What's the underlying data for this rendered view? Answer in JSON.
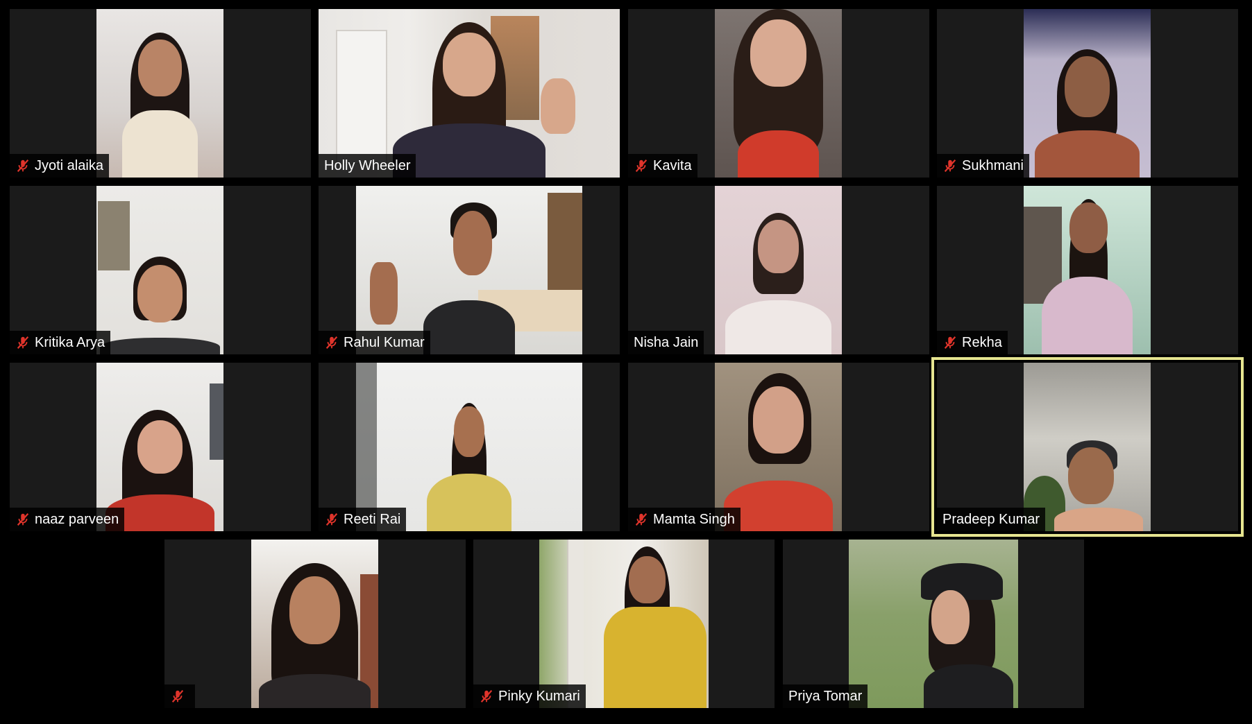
{
  "meeting": {
    "view": "gallery",
    "active_speaker": "Pradeep Kumar",
    "colors": {
      "background": "#000000",
      "tile": "#1b1b1b",
      "active_border": "#e6e590",
      "muted_icon": "#e0342b",
      "nameplate_text": "#ffffff"
    }
  },
  "participants": [
    {
      "name": "Jyoti alaika",
      "muted": true
    },
    {
      "name": "Holly Wheeler",
      "muted": false
    },
    {
      "name": "Kavita",
      "muted": true
    },
    {
      "name": "Sukhmani",
      "muted": true
    },
    {
      "name": "Kritika Arya",
      "muted": true
    },
    {
      "name": "Rahul Kumar",
      "muted": true
    },
    {
      "name": "Nisha Jain",
      "muted": false
    },
    {
      "name": "Rekha",
      "muted": true
    },
    {
      "name": "naaz parveen",
      "muted": true
    },
    {
      "name": "Reeti Rai",
      "muted": true
    },
    {
      "name": "Mamta Singh",
      "muted": true
    },
    {
      "name": "Pradeep Kumar",
      "muted": false
    },
    {
      "name": "",
      "muted": true
    },
    {
      "name": "Pinky Kumari",
      "muted": true
    },
    {
      "name": "Priya Tomar",
      "muted": false
    }
  ]
}
